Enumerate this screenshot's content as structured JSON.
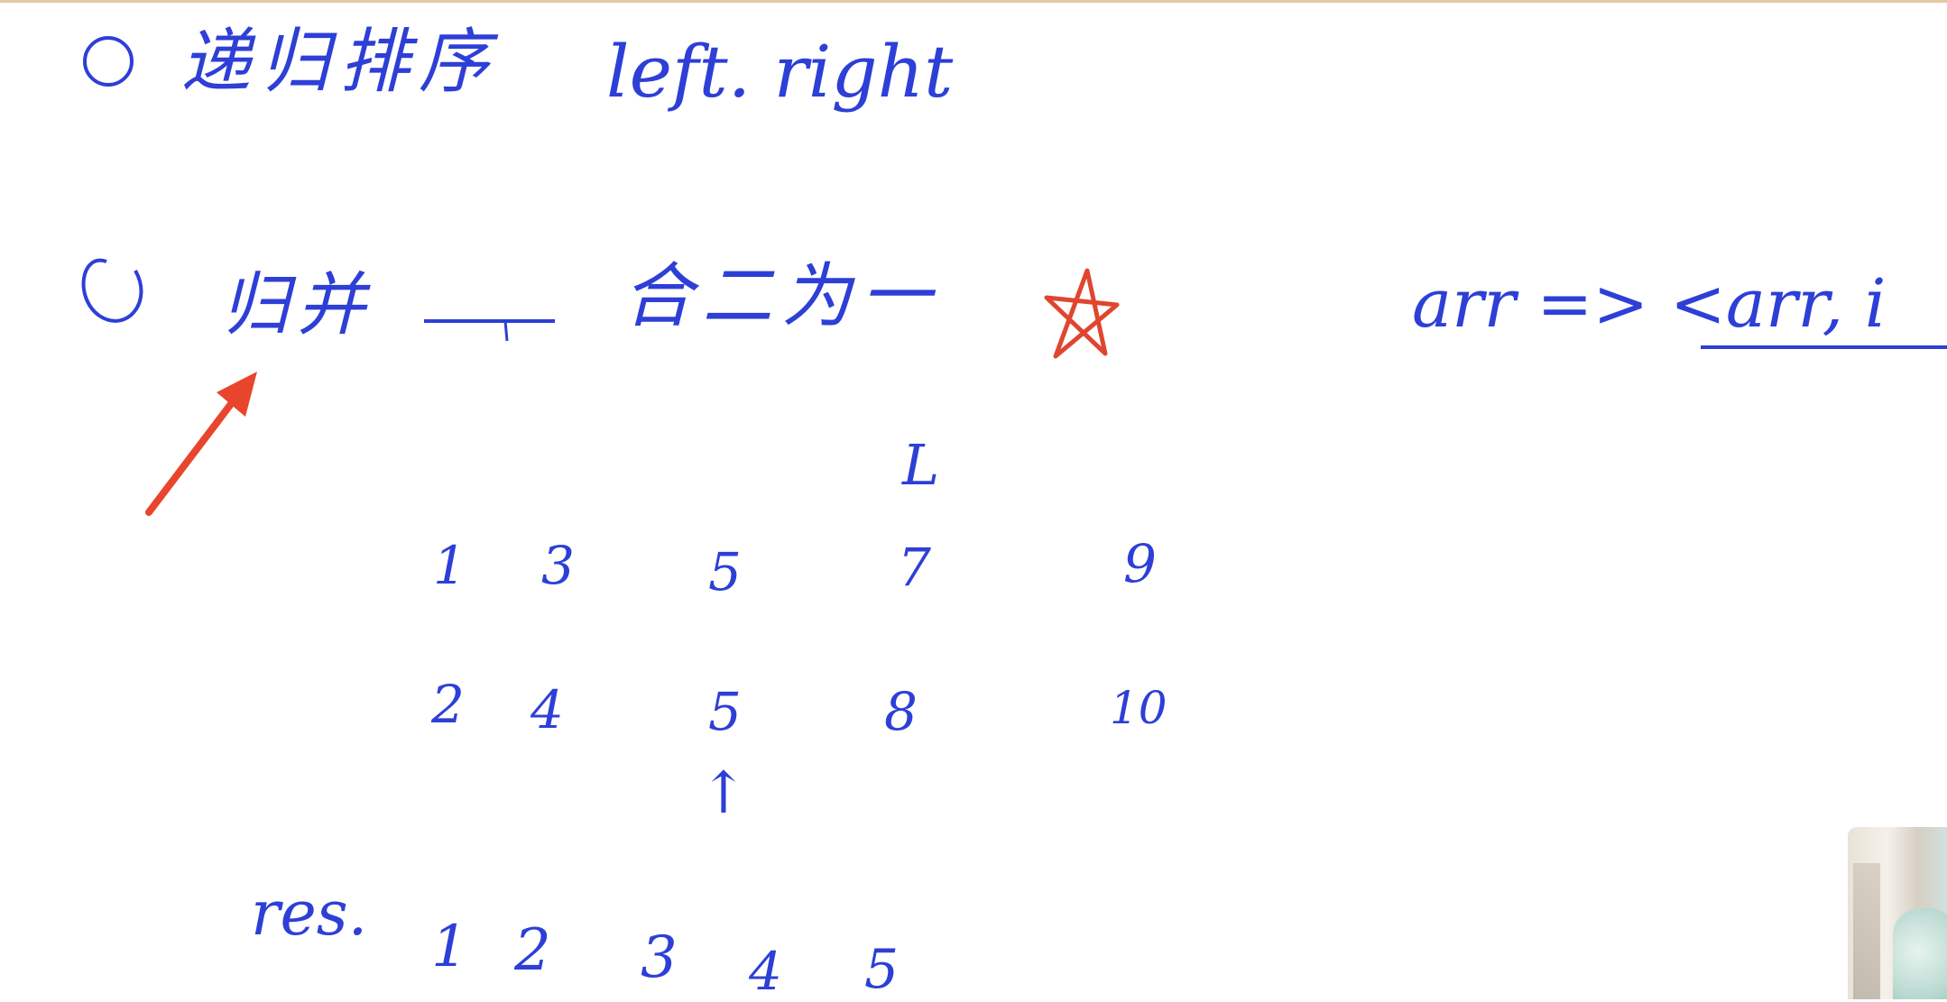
{
  "whiteboard": {
    "line1": {
      "circled_number": "①",
      "chinese": "递归排序",
      "latin": "left. right"
    },
    "line2": {
      "circled_number": "②",
      "term": "归并",
      "meaning": "合二为一",
      "star_color": "#e0462f",
      "right_note": "arr => <arr, i"
    },
    "pointer_letter": "L",
    "row1": [
      "1",
      "3",
      "5",
      "7",
      "9"
    ],
    "row2": [
      "2",
      "4",
      "5",
      "8",
      "10"
    ],
    "up_arrow": "↑",
    "result": {
      "label": "res.",
      "values": [
        "1",
        "2",
        "3",
        "4",
        "5"
      ]
    },
    "ink_color": "#2d3fd6",
    "arrow_color": "#e8452c"
  }
}
